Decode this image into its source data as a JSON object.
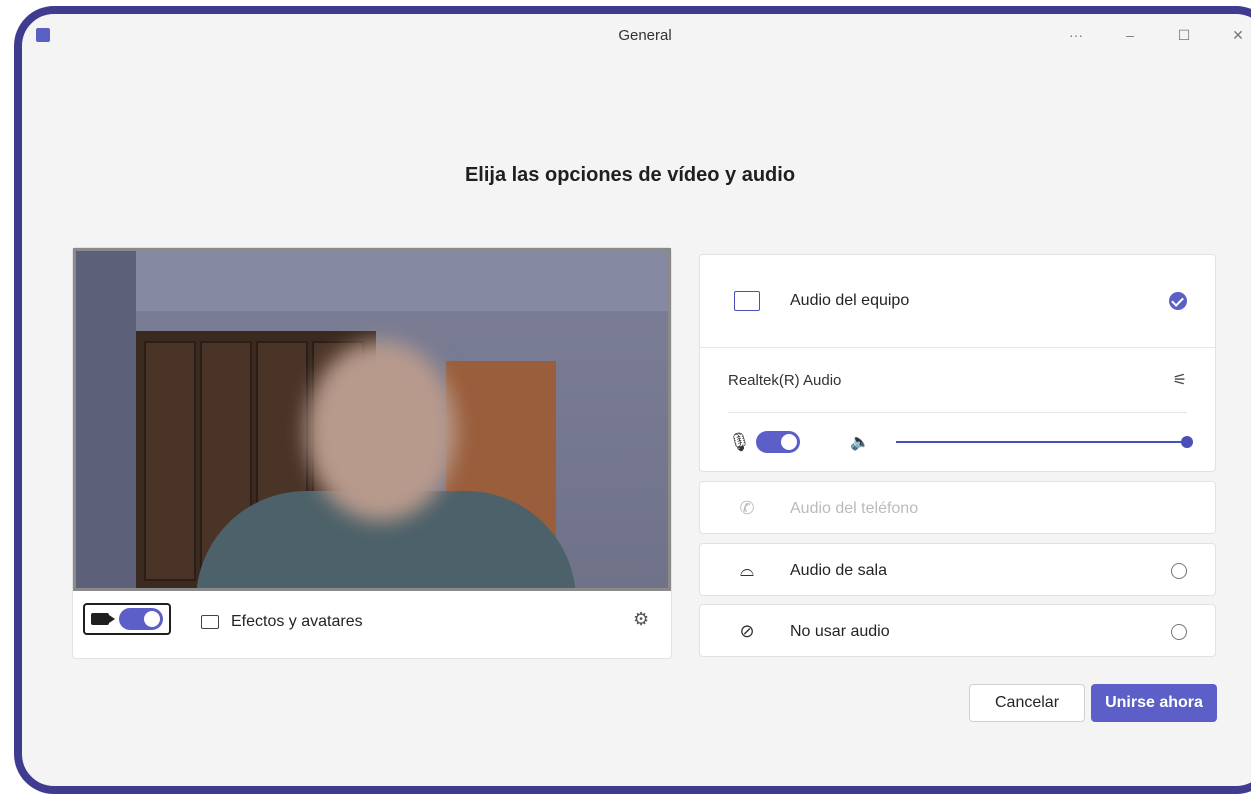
{
  "window": {
    "title": "General",
    "more_label": "···",
    "minimize_label": "–",
    "maximize_label": "☐",
    "close_label": "✕"
  },
  "heading": "Elija las opciones de vídeo y audio",
  "video": {
    "camera_on": true,
    "effects_label": "Efectos y avatares"
  },
  "audio": {
    "computer_audio_label": "Audio del equipo",
    "computer_audio_selected": true,
    "device_name": "Realtek(R) Audio",
    "mic_on": true,
    "speaker_volume_fraction": 1.0,
    "phone_audio_label": "Audio del teléfono",
    "room_audio_label": "Audio de sala",
    "no_audio_label": "No usar audio"
  },
  "buttons": {
    "cancel": "Cancelar",
    "join": "Unirse ahora"
  },
  "colors": {
    "accent": "#5b5fc7",
    "frame": "#3f3b8f"
  },
  "icons": [
    "app-icon",
    "camera-icon",
    "effects-icon",
    "gear-icon",
    "monitor-speaker-icon",
    "check-icon",
    "sliders-icon",
    "mic-icon",
    "speaker-icon",
    "phone-icon",
    "room-icon",
    "no-audio-icon"
  ]
}
